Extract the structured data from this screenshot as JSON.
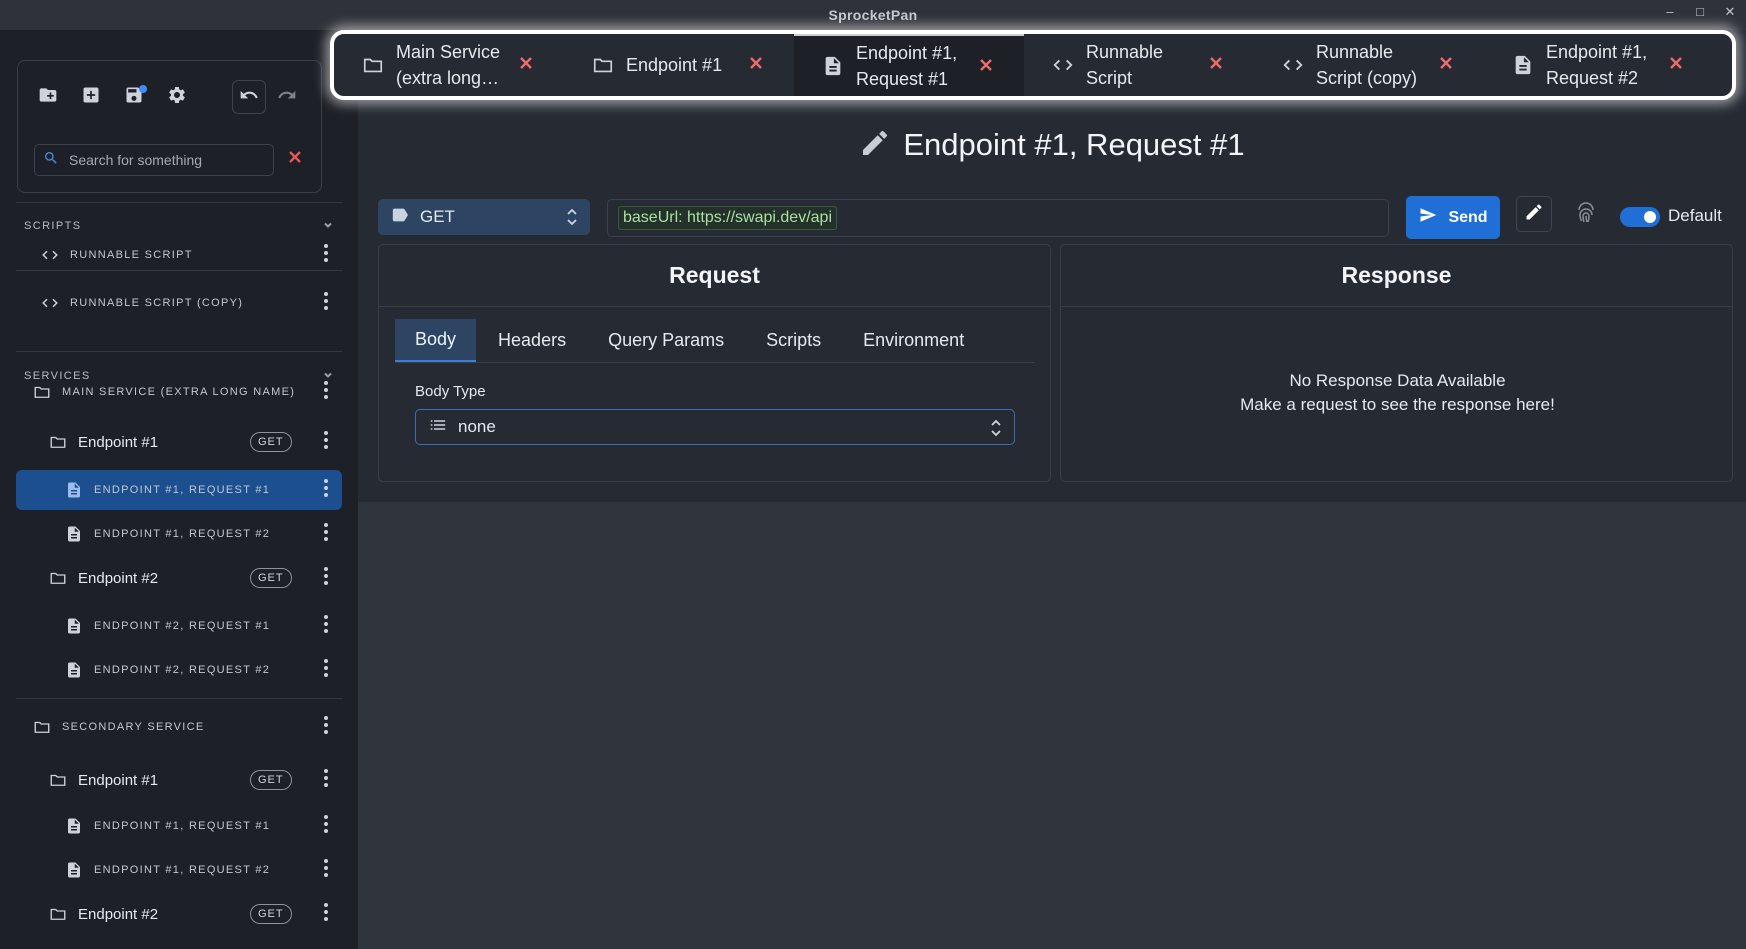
{
  "window": {
    "title": "SprocketPan",
    "controls": [
      "–",
      "□",
      "✕"
    ]
  },
  "sidebar": {
    "search": {
      "placeholder": "Search for something",
      "value": ""
    },
    "sections": {
      "scripts": "SCRIPTS",
      "services": "SERVICES"
    },
    "scripts": [
      {
        "label": "RUNNABLE SCRIPT",
        "icon": "code-icon"
      },
      {
        "label": "RUNNABLE SCRIPT (COPY)",
        "icon": "code-icon"
      }
    ],
    "services": [
      {
        "label": "MAIN SERVICE (EXTRA LONG NAME)",
        "kind": "service"
      },
      {
        "label": "Endpoint #1",
        "kind": "endpoint",
        "badge": "GET"
      },
      {
        "label": "ENDPOINT #1, REQUEST #1",
        "kind": "request",
        "selected": true
      },
      {
        "label": "ENDPOINT #1, REQUEST #2",
        "kind": "request"
      },
      {
        "label": "Endpoint #2",
        "kind": "endpoint",
        "badge": "GET"
      },
      {
        "label": "ENDPOINT #2, REQUEST #1",
        "kind": "request"
      },
      {
        "label": "ENDPOINT #2, REQUEST #2",
        "kind": "request"
      },
      {
        "label": "SECONDARY SERVICE",
        "kind": "service"
      },
      {
        "label": "Endpoint #1",
        "kind": "endpoint",
        "badge": "GET"
      },
      {
        "label": "ENDPOINT #1, REQUEST #1",
        "kind": "request"
      },
      {
        "label": "ENDPOINT #1, REQUEST #2",
        "kind": "request"
      },
      {
        "label": "Endpoint #2",
        "kind": "endpoint",
        "badge": "GET"
      }
    ]
  },
  "tabs": [
    {
      "label": "Main Service (extra long name)",
      "icon": "folder-icon",
      "active": false
    },
    {
      "label": "Endpoint #1",
      "icon": "folder-icon",
      "active": false
    },
    {
      "label": "Endpoint #1, Request #1",
      "icon": "document-icon",
      "active": true
    },
    {
      "label": "Runnable Script",
      "icon": "code-icon",
      "active": false
    },
    {
      "label": "Runnable Script (copy)",
      "icon": "code-icon",
      "active": false
    },
    {
      "label": "Endpoint #1, Request #2",
      "icon": "document-icon",
      "active": false
    }
  ],
  "main": {
    "title": "Endpoint #1, Request #1",
    "method": "GET",
    "url_chip": "baseUrl: https://swapi.dev/api",
    "send_label": "Send",
    "toggle_label": "Default",
    "toggle_on": true,
    "request": {
      "heading": "Request",
      "tabs": [
        "Body",
        "Headers",
        "Query Params",
        "Scripts",
        "Environment"
      ],
      "active_tab": "Body",
      "body_type_label": "Body Type",
      "body_type_value": "none"
    },
    "response": {
      "heading": "Response",
      "empty_title": "No Response Data Available",
      "empty_sub": "Make a request to see the response here!"
    }
  },
  "colors": {
    "accent": "#1f6fd6",
    "selected": "#1c4f8f",
    "close": "#ee6b6b",
    "document_icon": "#9dbbeb"
  }
}
